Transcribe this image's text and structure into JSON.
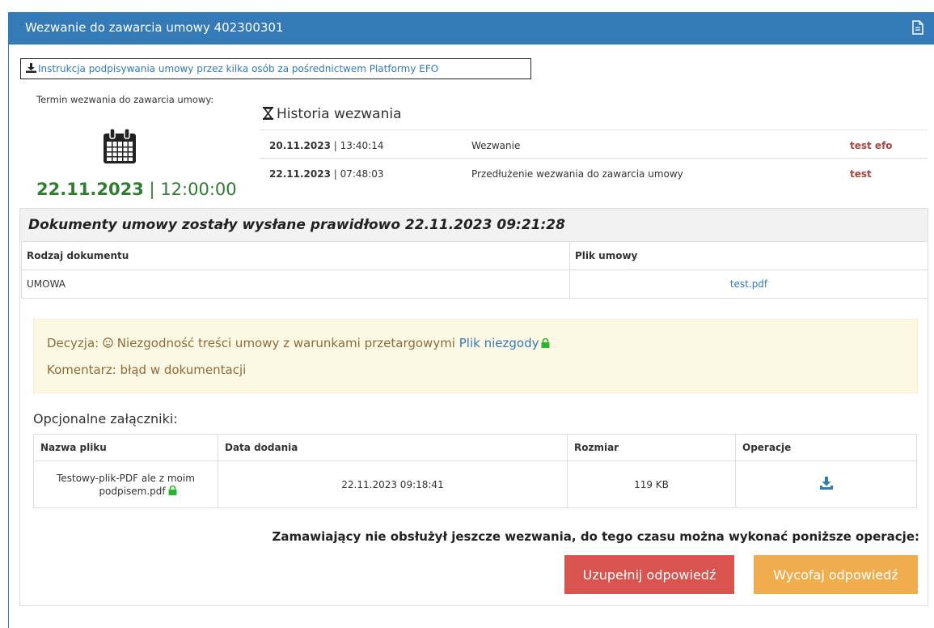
{
  "header": {
    "title": "Wezwanie do zawarcia umowy 402300301",
    "icon": "document-icon"
  },
  "instruction_link": "Instrukcja podpisywania umowy przez kilka osób za pośrednictwem Platformy EFO",
  "deadline": {
    "label": "Termin wezwania do zawarcia umowy:",
    "date": "22.11.2023",
    "separator": "|",
    "time": "12:00:00"
  },
  "history": {
    "title": "Historia wezwania",
    "rows": [
      {
        "date": "20.11.2023",
        "time": "13:40:14",
        "event": "Wezwanie",
        "user": "test efo"
      },
      {
        "date": "22.11.2023",
        "time": "07:48:03",
        "event": "Przedłużenie wezwania do zawarcia umowy",
        "user": "test"
      }
    ]
  },
  "documents": {
    "heading": "Dokumenty umowy zostały wysłane prawidłowo 22.11.2023 09:21:28",
    "columns": [
      "Rodzaj dokumentu",
      "Plik umowy"
    ],
    "rows": [
      {
        "type": "UMOWA",
        "file": "test.pdf"
      }
    ]
  },
  "decision": {
    "label": "Decyzja:",
    "text": "Niezgodność treści umowy z warunkami przetargowymi",
    "file_link": "Plik niezgody",
    "comment": "Komentarz: błąd w dokumentacji"
  },
  "attachments": {
    "label": "Opcjonalne załączniki:",
    "columns": [
      "Nazwa pliku",
      "Data dodania",
      "Rozmiar",
      "Operacje"
    ],
    "rows": [
      {
        "name_line1": "Testowy-plik-PDF ale z moim",
        "name_line2": "podpisem.pdf",
        "date": "22.11.2023 09:18:41",
        "size": "119 KB"
      }
    ]
  },
  "notice": "Zamawiający nie obsłużył jeszcze wezwania, do tego czasu można wykonać poniższe operacje:",
  "buttons": {
    "complete": "Uzupełnij odpowiedź",
    "withdraw": "Wycofaj odpowiedź"
  },
  "colors": {
    "header": "#337ab7",
    "date_green": "#2e7d32",
    "user_red": "#a94442",
    "btn_red": "#d9534f",
    "btn_orange": "#f0ad4e",
    "lock_green": "#2bb52b"
  }
}
